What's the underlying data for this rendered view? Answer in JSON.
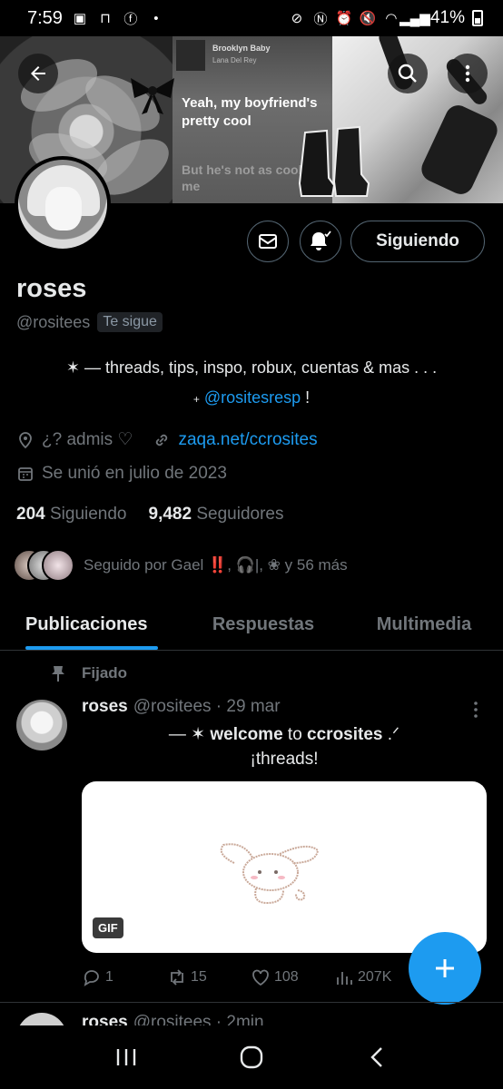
{
  "status_bar": {
    "time": "7:59",
    "battery": "41%"
  },
  "banner": {
    "song_title": "Brooklyn Baby",
    "song_artist": "Lana Del Rey",
    "lyric_line": "Yeah, my boyfriend's pretty cool",
    "lyric_next": "But he's not as cool as me"
  },
  "profile": {
    "name": "roses",
    "handle": "@rositees",
    "follows_you": "Te sigue",
    "bio_line1": "✶ —  threads, tips, inspo, robux, cuentas & mas . . .",
    "bio_line2_prefix": "+",
    "bio_line2_link": "@rositesresp",
    "bio_line2_suffix": " !",
    "location": "¿? admis ♡",
    "website": "zaqa.net/ccrosites",
    "joined": "Se unió en julio de 2023",
    "following_count": "204",
    "following_label": "Siguiendo",
    "followers_count": "9,482",
    "followers_label": "Seguidores",
    "followed_by": "Seguido por Gael ‼️, 🎧|, ❀ y 56 más"
  },
  "buttons": {
    "follow_state": "Siguiendo"
  },
  "tabs": [
    {
      "label": "Publicaciones"
    },
    {
      "label": "Respuestas"
    },
    {
      "label": "Multimedia"
    }
  ],
  "pinned_post": {
    "pinned_label": "Fijado",
    "author": "roses",
    "handle_time": "@rositees · 29 mar",
    "line1_prefix": "—   ✶  ",
    "line1_bold1": "welcome",
    "line1_mid": " to ",
    "line1_bold2": "ccrosites",
    "line1_suffix": " .ᐟ",
    "line2": "¡threads!",
    "media_badge": "GIF",
    "replies": "1",
    "reposts": "15",
    "likes": "108",
    "views": "207K"
  },
  "next_post": {
    "author": "roses",
    "handle_time": "@rositees · 2min"
  },
  "colors": {
    "accent": "#1d9bf0",
    "muted": "#71767b",
    "background": "#000000"
  }
}
